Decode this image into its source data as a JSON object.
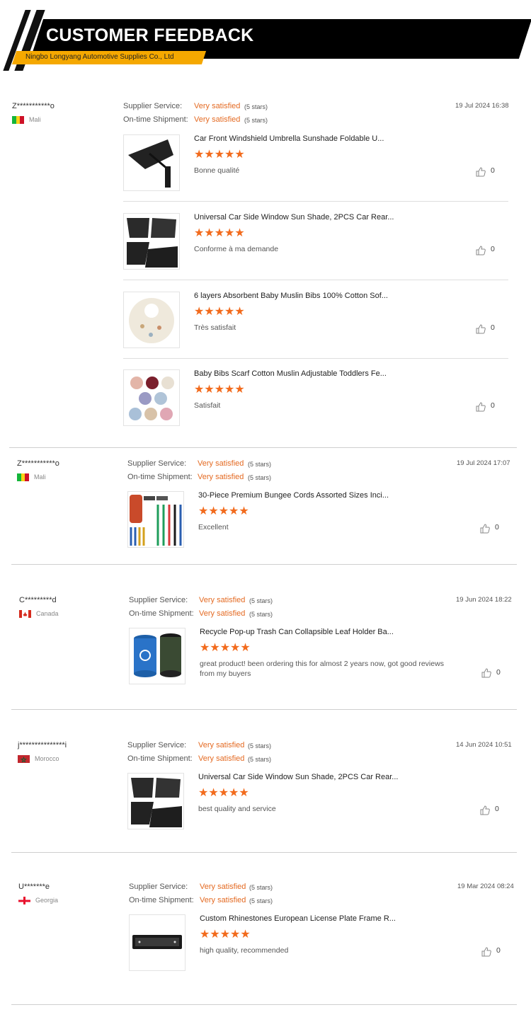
{
  "header": {
    "title": "CUSTOMER FEEDBACK",
    "company": "Ningbo Longyang Automotive Supplies Co., Ltd"
  },
  "colors": {
    "accent": "#e46a22",
    "star": "#f26b1d",
    "banner_black": "#000000",
    "banner_yellow": "#f5a800"
  },
  "labels": {
    "supplier_service": "Supplier Service:",
    "on_time_shipment": "On-time Shipment:"
  },
  "reviews": [
    {
      "user": "Z***********o",
      "country": "Mali",
      "flag": "mali-flag",
      "date": "19 Jul 2024 16:38",
      "supplier_rating": "Very satisfied",
      "supplier_count": "(5 stars)",
      "shipment_rating": "Very satisfied",
      "shipment_count": "(5 stars)",
      "items": [
        {
          "name": "Car Front Windshield Umbrella Sunshade Foldable U...",
          "stars": 5,
          "comment": "Bonne qualité",
          "likes": "0",
          "image": "umbrella-sunshade-image"
        },
        {
          "name": "Universal Car Side Window Sun Shade, 2PCS Car Rear...",
          "stars": 5,
          "comment": "Conforme à ma demande",
          "likes": "0",
          "image": "window-sunshade-image"
        },
        {
          "name": "6 layers Absorbent Baby Muslin Bibs 100% Cotton Sof...",
          "stars": 5,
          "comment": "Très satisfait",
          "likes": "0",
          "image": "baby-bib-image"
        },
        {
          "name": "Baby Bibs Scarf Cotton Muslin Adjustable Toddlers Fe...",
          "stars": 5,
          "comment": "Satisfait",
          "likes": "0",
          "image": "bibs-scarf-image"
        }
      ]
    },
    {
      "user": "Z***********o",
      "country": "Mali",
      "flag": "mali-flag",
      "date": "19 Jul 2024 17:07",
      "supplier_rating": "Very satisfied",
      "supplier_count": "(5 stars)",
      "shipment_rating": "Very satisfied",
      "shipment_count": "(5 stars)",
      "items": [
        {
          "name": "30-Piece Premium Bungee Cords Assorted Sizes Inci...",
          "stars": 5,
          "comment": "Excellent",
          "likes": "0",
          "image": "bungee-cords-image"
        }
      ]
    },
    {
      "user": "C*********d",
      "country": "Canada",
      "flag": "canada-flag",
      "date": "19 Jun 2024 18:22",
      "supplier_rating": "Very satisfied",
      "supplier_count": "(5 stars)",
      "shipment_rating": "Very satisfied",
      "shipment_count": "(5 stars)",
      "items": [
        {
          "name": "Recycle Pop-up Trash Can Collapsible Leaf Holder Ba...",
          "stars": 5,
          "comment": "great product!  been ordering this for almost 2 years now, got good reviews from my buyers",
          "likes": "0",
          "image": "trash-can-image"
        }
      ]
    },
    {
      "user": "j***************i",
      "country": "Morocco",
      "flag": "morocco-flag",
      "date": "14 Jun 2024 10:51",
      "supplier_rating": "Very satisfied",
      "supplier_count": "(5 stars)",
      "shipment_rating": "Very satisfied",
      "shipment_count": "(5 stars)",
      "items": [
        {
          "name": "Universal Car Side Window Sun Shade, 2PCS Car Rear...",
          "stars": 5,
          "comment": "best quality and service",
          "likes": "0",
          "image": "window-sunshade-image"
        }
      ]
    },
    {
      "user": "U*******e",
      "country": "Georgia",
      "flag": "georgia-flag",
      "date": "19 Mar 2024 08:24",
      "supplier_rating": "Very satisfied",
      "supplier_count": "(5 stars)",
      "shipment_rating": "Very satisfied",
      "shipment_count": "(5 stars)",
      "items": [
        {
          "name": "Custom Rhinestones European License Plate Frame R...",
          "stars": 5,
          "comment": "high quality, recommended",
          "likes": "0",
          "image": "license-plate-frame-image"
        }
      ]
    }
  ]
}
